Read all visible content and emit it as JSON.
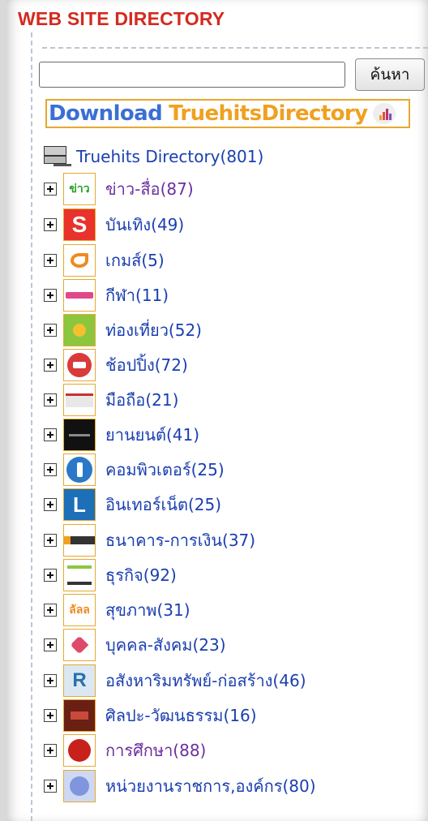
{
  "header": {
    "title": "WEB SITE DIRECTORY"
  },
  "search": {
    "value": "",
    "placeholder": "",
    "button_label": "ค้นหา"
  },
  "banner": {
    "word1": "Download",
    "word2": "TruehitsDirectory"
  },
  "root": {
    "label": "Truehits Directory(801)"
  },
  "categories": [
    {
      "label": "ข่าว-สื่อ(87)",
      "icon": "news-thumbnail",
      "visited": true
    },
    {
      "label": "บันเทิง(49)",
      "icon": "entertainment-thumbnail",
      "visited": false
    },
    {
      "label": "เกมส์(5)",
      "icon": "games-thumbnail",
      "visited": false
    },
    {
      "label": "กีฬา(11)",
      "icon": "sports-thumbnail",
      "visited": false
    },
    {
      "label": "ท่องเที่ยว(52)",
      "icon": "travel-thumbnail",
      "visited": false
    },
    {
      "label": "ช้อปปิ้ง(72)",
      "icon": "shopping-thumbnail",
      "visited": false
    },
    {
      "label": "มือถือ(21)",
      "icon": "mobile-thumbnail",
      "visited": false
    },
    {
      "label": "ยานยนต์(41)",
      "icon": "automotive-thumbnail",
      "visited": false
    },
    {
      "label": "คอมพิวเตอร์(25)",
      "icon": "computer-thumbnail",
      "visited": false
    },
    {
      "label": "อินเทอร์เน็ต(25)",
      "icon": "internet-thumbnail",
      "visited": false
    },
    {
      "label": "ธนาคาร-การเงิน(37)",
      "icon": "finance-thumbnail",
      "visited": false
    },
    {
      "label": "ธุรกิจ(92)",
      "icon": "business-thumbnail",
      "visited": false
    },
    {
      "label": "สุขภาพ(31)",
      "icon": "health-thumbnail",
      "visited": false
    },
    {
      "label": "บุคคล-สังคม(23)",
      "icon": "people-thumbnail",
      "visited": false
    },
    {
      "label": "อสังหาริมทรัพย์-ก่อสร้าง(46)",
      "icon": "real-estate-thumbnail",
      "visited": false
    },
    {
      "label": "ศิลปะ-วัฒนธรรม(16)",
      "icon": "art-thumbnail",
      "visited": false
    },
    {
      "label": "การศึกษา(88)",
      "icon": "education-thumbnail",
      "visited": true
    },
    {
      "label": "หน่วยงานราชการ,องค์กร(80)",
      "icon": "government-thumbnail",
      "visited": false
    }
  ],
  "colors": {
    "header": "#d42a1f",
    "link": "#1a3fb0",
    "visited_link": "#6b2fa0",
    "banner_blue": "#3b6fd4",
    "banner_orange": "#f0a020",
    "border_accent": "#e6a832"
  }
}
